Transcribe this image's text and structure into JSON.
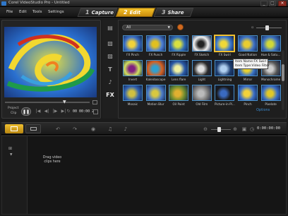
{
  "window": {
    "title": "Corel VideoStudio Pro - Untitled",
    "minimize": "_",
    "maximize": "□",
    "close": "×"
  },
  "menu": {
    "items": [
      "File",
      "Edit",
      "Tools",
      "Settings"
    ]
  },
  "steps": [
    {
      "num": "1",
      "label": "Capture"
    },
    {
      "num": "2",
      "label": "Edit"
    },
    {
      "num": "3",
      "label": "Share"
    }
  ],
  "preview": {
    "project_label": "Project",
    "clip_label": "Clip",
    "timecode": "00 00:00 2"
  },
  "library": {
    "filter_value": "All",
    "thumbnails": [
      {
        "label": "FX Pinch",
        "c1": "#3a6ec8",
        "c2": "#f2d23a"
      },
      {
        "label": "FX Punch",
        "c1": "#4a7ed8",
        "c2": "#e0c020"
      },
      {
        "label": "FX Ripple",
        "c1": "#2e6ab8",
        "c2": "#d8e040"
      },
      {
        "label": "FX Sketch",
        "c1": "#f0f0f0",
        "c2": "#222222"
      },
      {
        "label": "FX Swirl",
        "c1": "#3a78d0",
        "c2": "#f0d838"
      },
      {
        "label": "Good Nation",
        "c1": "#3e72c8",
        "c2": "#e8cc30"
      },
      {
        "label": "Hue & Satu...",
        "c1": "#3b6fc0",
        "c2": "#d0d838"
      },
      {
        "label": "Invert",
        "c1": "#d0e060",
        "c2": "#802080"
      },
      {
        "label": "Kaleidoscope",
        "c1": "#d86020",
        "c2": "#30a0d0"
      },
      {
        "label": "Lens flare",
        "c1": "#2a5aa8",
        "c2": "#f0f0a0"
      },
      {
        "label": "Light",
        "c1": "#2a2a2a",
        "c2": "#e0e0e0"
      },
      {
        "label": "Lightning",
        "c1": "#1e3e70",
        "c2": "#b0d0f0"
      },
      {
        "label": "Mirror",
        "c1": "#3a74c8",
        "c2": "#e8d030"
      },
      {
        "label": "Monochrome",
        "c1": "#555555",
        "c2": "#cccccc"
      },
      {
        "label": "Mosaic",
        "c1": "#3060b0",
        "c2": "#d0c040"
      },
      {
        "label": "Motion Blur",
        "c1": "#4a7ac8",
        "c2": "#d8c840"
      },
      {
        "label": "Oil Paint",
        "c1": "#6a8a30",
        "c2": "#e0b030"
      },
      {
        "label": "Old Film",
        "c1": "#777777",
        "c2": "#bbbbbb"
      },
      {
        "label": "Picture-in-Pi...",
        "c1": "#1a1a1a",
        "c2": "#3a6ac0"
      },
      {
        "label": "Pinch",
        "c1": "#3a6ec8",
        "c2": "#f2d23a"
      },
      {
        "label": "Pixelate",
        "c1": "#3a6ec8",
        "c2": "#e0c828"
      }
    ],
    "tooltip_line1": "Item Name:FX Swirl",
    "tooltip_line2": "Item Type:Video Filter",
    "options_label": "Options"
  },
  "storyboard": {
    "drag_hint": "Drag video clips here"
  },
  "timeline": {
    "timecode": "0:00:00:00"
  },
  "icons": {
    "close": "close-icon",
    "play": "play-icon",
    "undo": "undo-icon",
    "redo": "redo-icon",
    "zoom_out": "zoom-out-icon",
    "zoom_in": "zoom-in-icon"
  },
  "colors": {
    "accent": "#f0b420",
    "selection": "#f0c030",
    "thumb_border": "#4a90c8"
  }
}
